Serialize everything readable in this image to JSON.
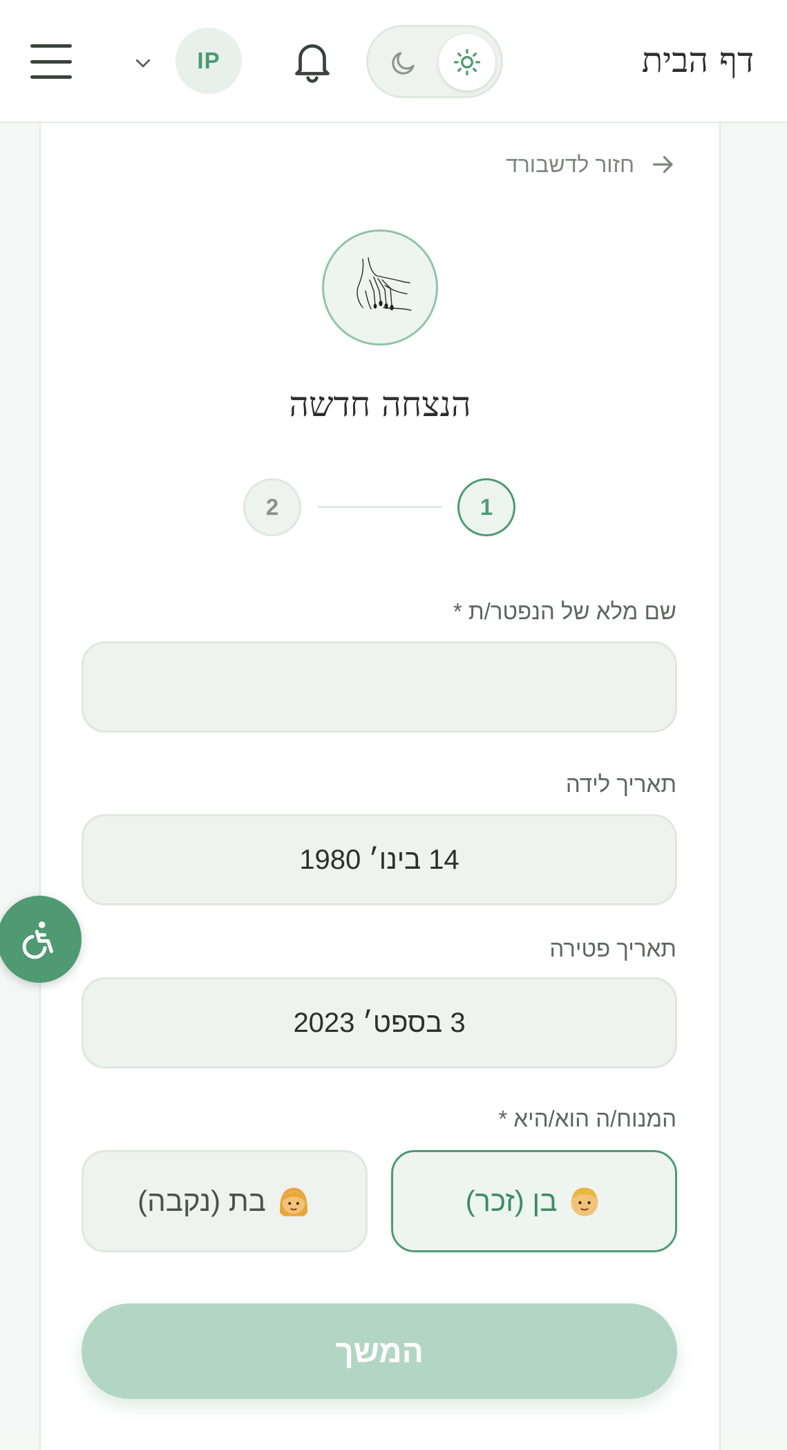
{
  "header": {
    "brand": "דף הבית",
    "avatar_initials": "IP",
    "menu_icon": "hamburger-icon",
    "notifications_icon": "bell-icon",
    "theme": {
      "dark_icon": "moon-icon",
      "light_icon": "sun-icon",
      "active": "light"
    }
  },
  "nav": {
    "back_label": "חזור לדשבורד"
  },
  "page": {
    "title": "הנצחה חדשה"
  },
  "stepper": {
    "steps": [
      "1",
      "2"
    ],
    "current": 1
  },
  "form": {
    "full_name": {
      "label": "שם מלא של הנפטר/ת *",
      "value": "",
      "placeholder": ""
    },
    "birth_date": {
      "label": "תאריך לידה",
      "value": "14 בינו׳ 1980"
    },
    "death_date": {
      "label": "תאריך פטירה",
      "value": "3 בספט׳ 2023"
    },
    "gender": {
      "label": "המנוח/ה הוא/היא *",
      "options": [
        {
          "label": "בן (זכר)",
          "icon": "man-emoji",
          "selected": true
        },
        {
          "label": "בת (נקבה)",
          "icon": "woman-emoji",
          "selected": false
        }
      ]
    },
    "submit_label": "המשך"
  },
  "colors": {
    "accent": "#4f9a72",
    "accent_light": "#b3d5c4",
    "field_bg": "#eef3ef"
  }
}
